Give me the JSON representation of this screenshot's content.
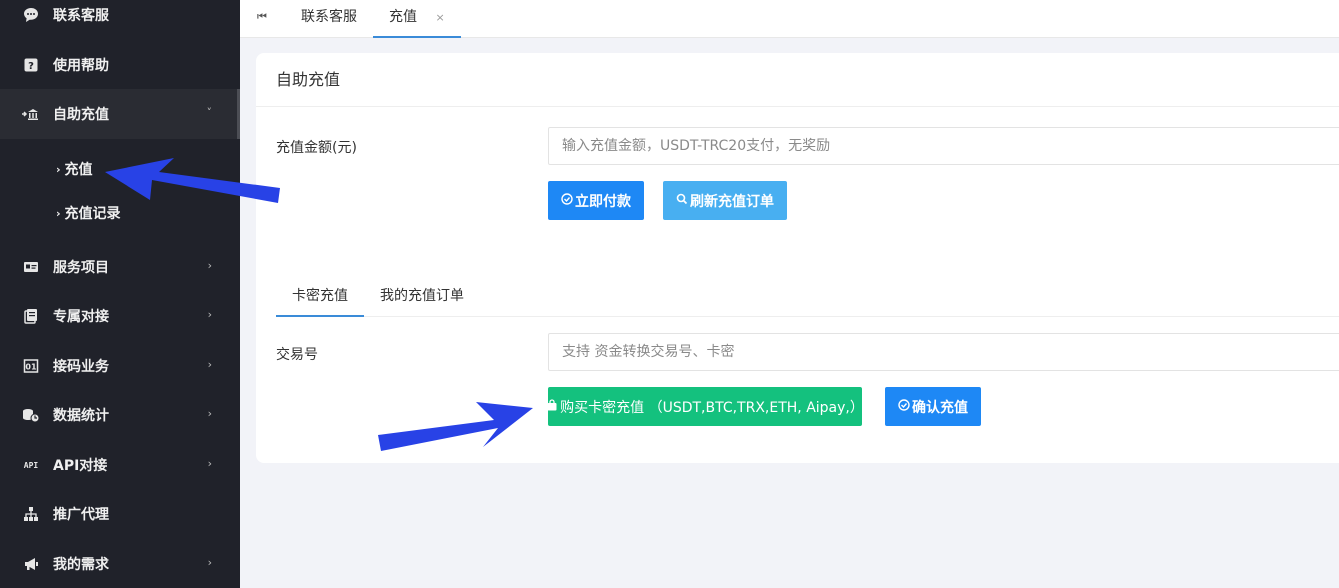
{
  "sidebar": {
    "items": [
      {
        "label": "联系客服",
        "icon": "chat-bubble-icon",
        "arrow": ""
      },
      {
        "label": "使用帮助",
        "icon": "help-icon",
        "arrow": ""
      },
      {
        "label": "自助充值",
        "icon": "bank-icon",
        "arrow": "˅"
      },
      {
        "label": "服务项目",
        "icon": "card-icon",
        "arrow": "›"
      },
      {
        "label": "专属对接",
        "icon": "docs-icon",
        "arrow": "›"
      },
      {
        "label": "接码业务",
        "icon": "phone-code-icon",
        "arrow": "›"
      },
      {
        "label": "数据统计",
        "icon": "stats-icon",
        "arrow": "›"
      },
      {
        "label": "API对接",
        "icon": "api-icon",
        "arrow": "›"
      },
      {
        "label": "推广代理",
        "icon": "network-icon",
        "arrow": ""
      },
      {
        "label": "我的需求",
        "icon": "megaphone-icon",
        "arrow": "›"
      }
    ],
    "sub_items": [
      {
        "label": "充值"
      },
      {
        "label": "充值记录"
      }
    ]
  },
  "topbar": {
    "tabs": [
      {
        "label": "联系客服"
      },
      {
        "label": "充值",
        "close": "×"
      }
    ]
  },
  "card": {
    "title": "自助充值",
    "amount_label": "充值金额(元)",
    "amount_placeholder": "输入充值金额，USDT-TRC20支付，无奖励",
    "pay_button": "立即付款",
    "refresh_button": "刷新充值订单",
    "tabs": [
      {
        "label": "卡密充值"
      },
      {
        "label": "我的充值订单"
      }
    ],
    "txn_label": "交易号",
    "txn_placeholder": "支持 资金转换交易号、卡密",
    "buy_button": "购买卡密充值 （USDT,BTC,TRX,ETH, Aipay,）",
    "confirm_button": "确认充值"
  },
  "colors": {
    "sidebar_bg": "#20222a",
    "primary": "#1e88f5",
    "light_blue": "#48aff1",
    "green": "#14c17e",
    "annotation_arrow": "#2842e6"
  }
}
